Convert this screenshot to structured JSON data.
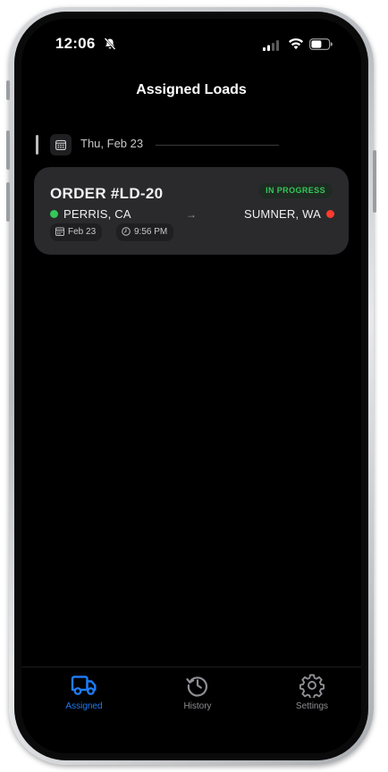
{
  "status_bar": {
    "time": "12:06"
  },
  "header": {
    "title": "Assigned Loads"
  },
  "date_group": {
    "label": "Thu, Feb 23"
  },
  "order": {
    "title": "ORDER #LD-20",
    "status": "IN PROGRESS",
    "origin": "PERRIS, CA",
    "arrow": "→",
    "destination": "SUMNER, WA",
    "date": "Feb 23",
    "time": "9:56 PM"
  },
  "tabs": [
    {
      "label": "Assigned",
      "icon": "truck-icon",
      "active": true
    },
    {
      "label": "History",
      "icon": "history-icon",
      "active": false
    },
    {
      "label": "Settings",
      "icon": "gear-icon",
      "active": false
    }
  ],
  "colors": {
    "accent": "#1f7bf2",
    "status_in_progress": "#34c759",
    "origin_dot": "#34c759",
    "destination_dot": "#ff3b30",
    "card_background": "#2a2a2d"
  }
}
